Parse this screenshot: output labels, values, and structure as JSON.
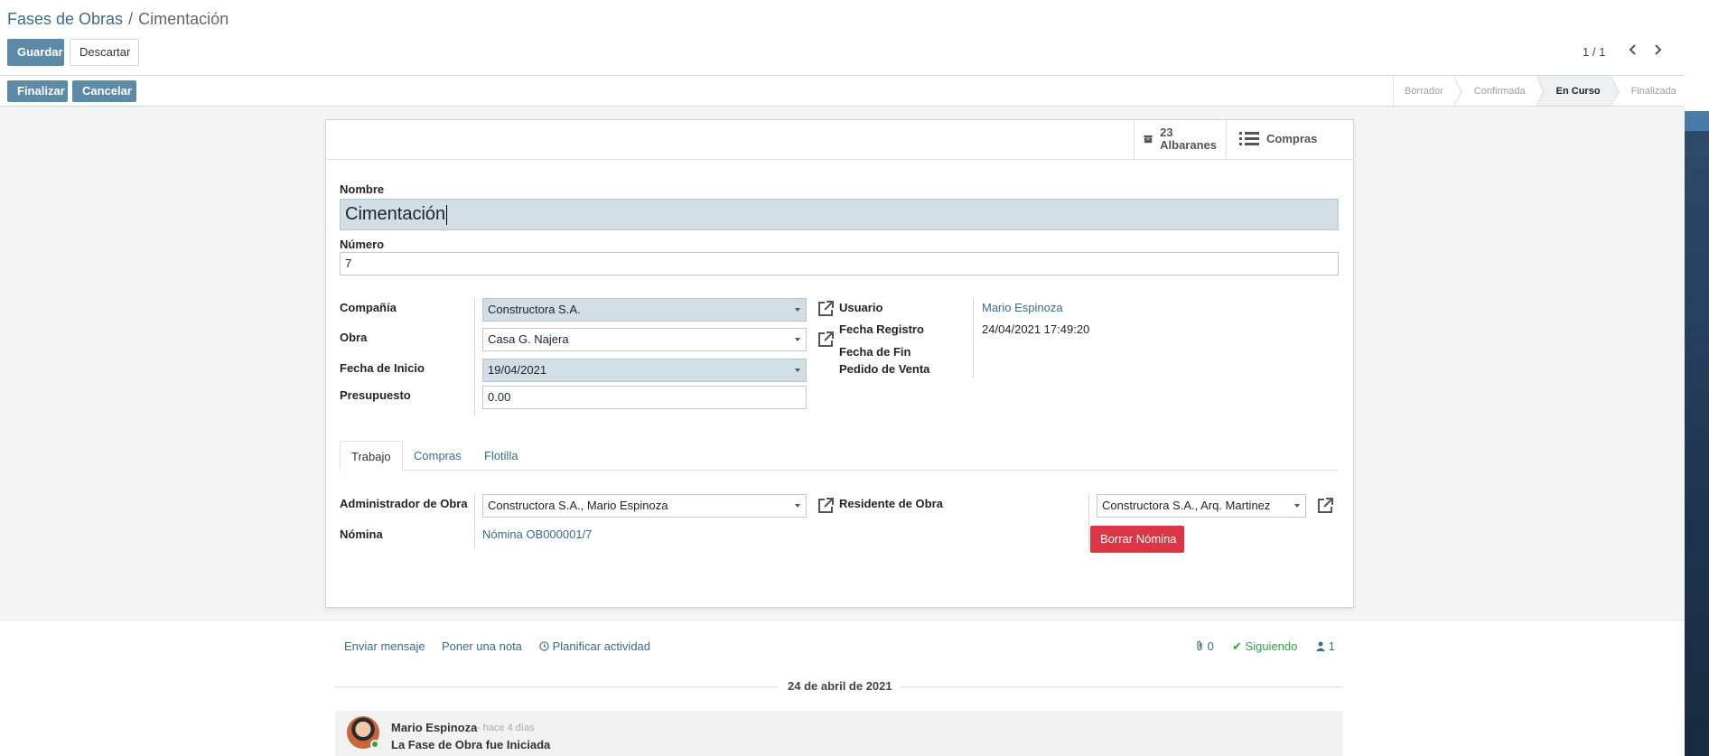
{
  "breadcrumb": {
    "parent": "Fases de Obras",
    "separator": "/",
    "current": "Cimentación"
  },
  "toolbar": {
    "save_label": "Guardar",
    "discard_label": "Descartar"
  },
  "pager": {
    "value": "1 / 1"
  },
  "header_buttons": {
    "finish_label": "Finalizar",
    "cancel_label": "Cancelar"
  },
  "statusbar": {
    "stages": [
      "Borrador",
      "Confirmada",
      "En Curso",
      "Finalizada"
    ],
    "active": "En Curso"
  },
  "smart_buttons": {
    "deliveries": {
      "count": "23",
      "label": "Albaranes",
      "icon": "archive-icon"
    },
    "purchases": {
      "label": "Compras",
      "icon": "list-icon"
    }
  },
  "form": {
    "name_label": "Nombre",
    "name_value": "Cimentación",
    "number_label": "Número",
    "number_value": "7",
    "company_label": "Compañía",
    "company_value": "Constructora S.A.",
    "work_label": "Obra",
    "work_value": "Casa G. Najera",
    "start_date_label": "Fecha de Inicio",
    "start_date_value": "19/04/2021",
    "budget_label": "Presupuesto",
    "budget_value": "0.00",
    "user_label": "Usuario",
    "user_value": "Mario Espinoza",
    "reg_date_label": "Fecha Registro",
    "reg_date_value": "24/04/2021 17:49:20",
    "end_date_label": "Fecha de Fin",
    "sale_order_label": "Pedido de Venta"
  },
  "tabs": [
    {
      "label": "Trabajo",
      "active": true
    },
    {
      "label": "Compras",
      "active": false
    },
    {
      "label": "Flotilla",
      "active": false
    }
  ],
  "work_tab": {
    "admin_label": "Administrador de Obra",
    "admin_value": "Constructora S.A., Mario Espinoza",
    "resident_label": "Residente de Obra",
    "resident_value": "Constructora S.A., Arq. Martinez",
    "payroll_label": "Nómina",
    "payroll_value": "Nómina OB000001/7",
    "delete_payroll_label": "Borrar Nómina"
  },
  "chatter": {
    "send_message": "Enviar mensaje",
    "log_note": "Poner una nota",
    "schedule_activity": "Planificar actividad",
    "attachments_count": "0",
    "following_label": "Siguiendo",
    "followers_count": "1",
    "date_separator": "24 de abril de 2021",
    "messages": [
      {
        "author": "Mario Espinoza",
        "ago": "- hace 4 días",
        "body": "La Fase de Obra fue Iniciada"
      }
    ]
  },
  "colors": {
    "primary": "#5d8aa7",
    "link": "#3a6c8c",
    "danger": "#dc3545",
    "success": "#28a745",
    "required_bg": "#d2dee6"
  }
}
